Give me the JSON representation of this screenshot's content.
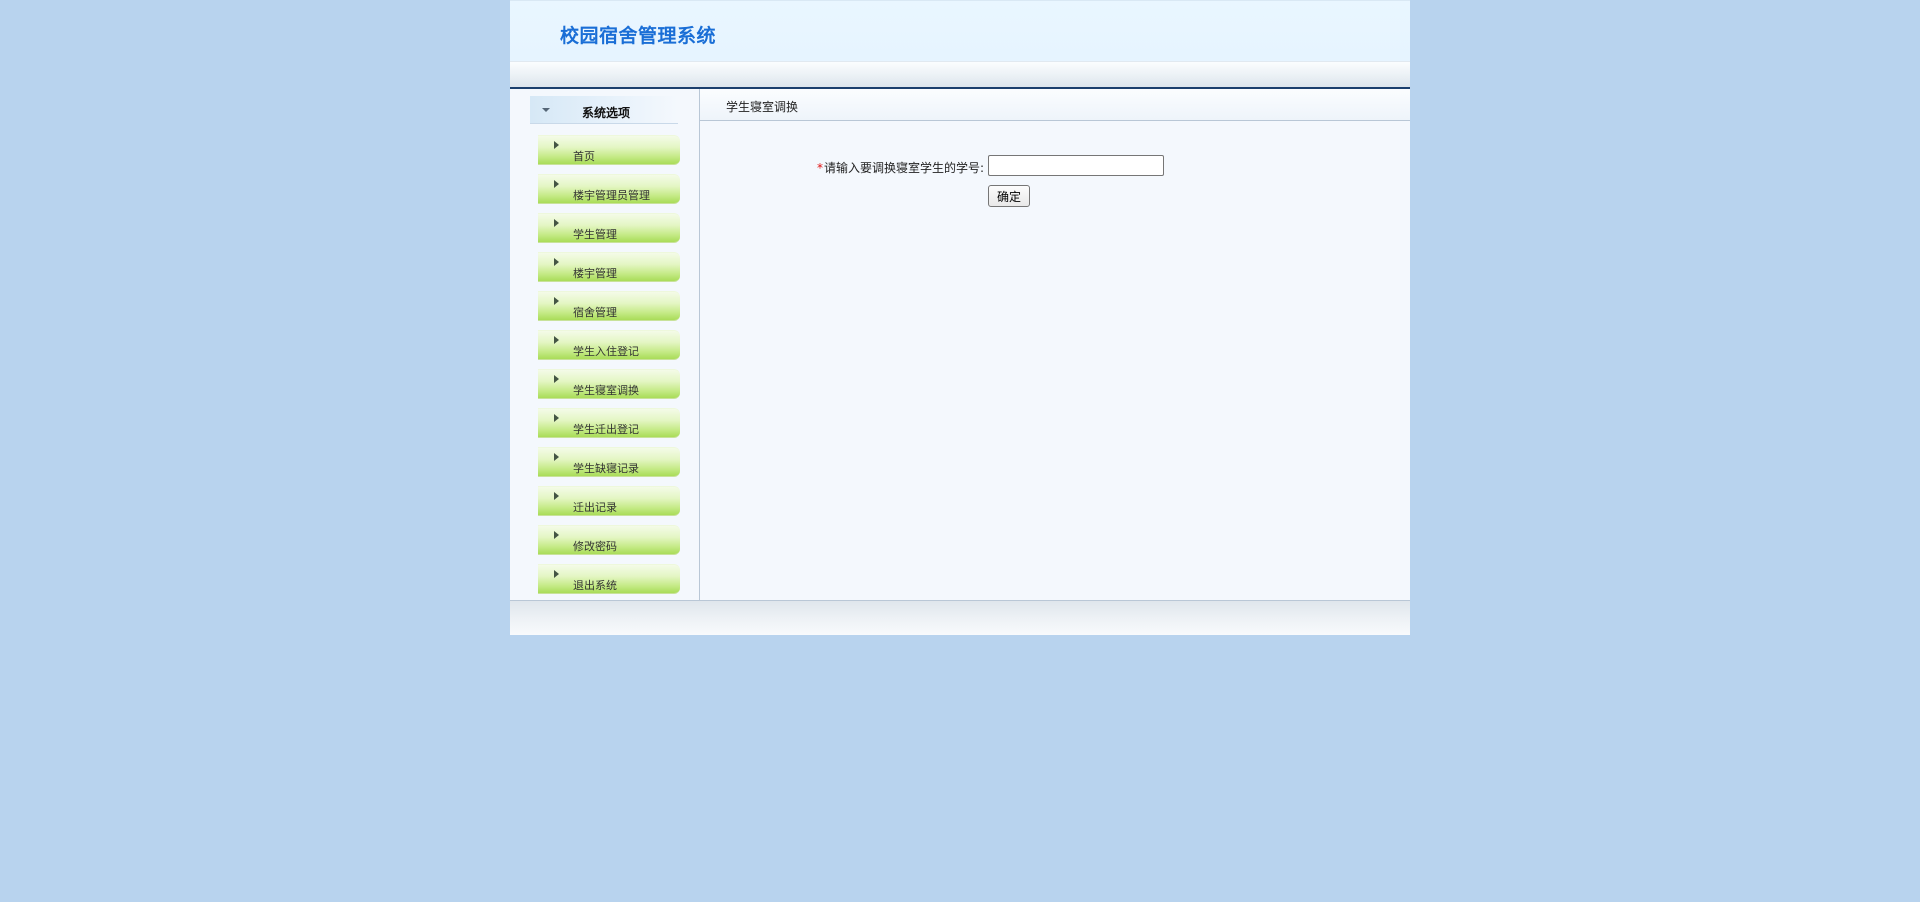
{
  "header": {
    "title": "校园宿舍管理系统"
  },
  "sidebar": {
    "heading": "系统选项",
    "heading_icon": "caret-down-icon",
    "item_icon": "triangle-right-icon",
    "items": [
      {
        "label": "首页"
      },
      {
        "label": "楼宇管理员管理"
      },
      {
        "label": "学生管理"
      },
      {
        "label": "楼宇管理"
      },
      {
        "label": "宿舍管理"
      },
      {
        "label": "学生入住登记"
      },
      {
        "label": "学生寝室调换"
      },
      {
        "label": "学生迁出登记"
      },
      {
        "label": "学生缺寝记录"
      },
      {
        "label": "迁出记录"
      },
      {
        "label": "修改密码"
      },
      {
        "label": "退出系统"
      }
    ]
  },
  "main": {
    "title": "学生寝室调换",
    "form": {
      "required_mark": "*",
      "label": "请输入要调换寝室学生的学号:",
      "input_value": "",
      "submit_label": "确定"
    }
  },
  "colors": {
    "page_background": "#b8d3ee",
    "title_blue": "#1a6ed6",
    "menu_green": "#a9dc58",
    "required_red": "#e01010"
  }
}
